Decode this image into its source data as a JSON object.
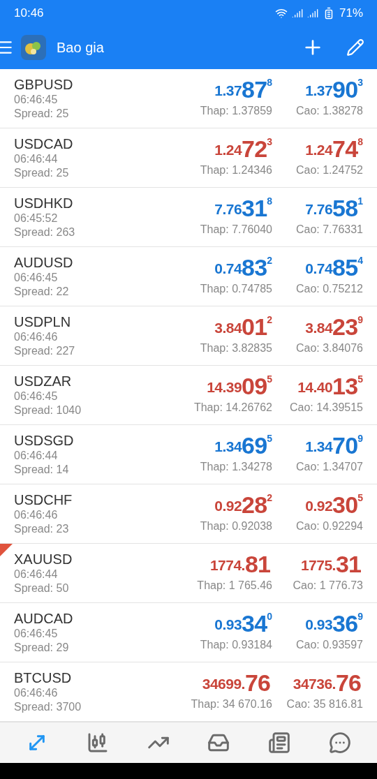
{
  "status_bar": {
    "time": "10:46",
    "battery": "71%"
  },
  "header": {
    "title": "Bao gia"
  },
  "quotes": [
    {
      "symbol": "GBPUSD",
      "time": "06:46:45",
      "spread": "Spread: 25",
      "rising": true,
      "marked": false,
      "bid": {
        "prefix": "1.37",
        "big": "87",
        "sup": "8"
      },
      "ask": {
        "prefix": "1.37",
        "big": "90",
        "sup": "3"
      },
      "low": "Thap: 1.37859",
      "high": "Cao: 1.38278"
    },
    {
      "symbol": "USDCAD",
      "time": "06:46:44",
      "spread": "Spread: 25",
      "rising": false,
      "marked": false,
      "bid": {
        "prefix": "1.24",
        "big": "72",
        "sup": "3"
      },
      "ask": {
        "prefix": "1.24",
        "big": "74",
        "sup": "8"
      },
      "low": "Thap: 1.24346",
      "high": "Cao: 1.24752"
    },
    {
      "symbol": "USDHKD",
      "time": "06:45:52",
      "spread": "Spread: 263",
      "rising": true,
      "marked": false,
      "bid": {
        "prefix": "7.76",
        "big": "31",
        "sup": "8"
      },
      "ask": {
        "prefix": "7.76",
        "big": "58",
        "sup": "1"
      },
      "low": "Thap: 7.76040",
      "high": "Cao: 7.76331"
    },
    {
      "symbol": "AUDUSD",
      "time": "06:46:45",
      "spread": "Spread: 22",
      "rising": true,
      "marked": false,
      "bid": {
        "prefix": "0.74",
        "big": "83",
        "sup": "2"
      },
      "ask": {
        "prefix": "0.74",
        "big": "85",
        "sup": "4"
      },
      "low": "Thap: 0.74785",
      "high": "Cao: 0.75212"
    },
    {
      "symbol": "USDPLN",
      "time": "06:46:46",
      "spread": "Spread: 227",
      "rising": false,
      "marked": false,
      "bid": {
        "prefix": "3.84",
        "big": "01",
        "sup": "2"
      },
      "ask": {
        "prefix": "3.84",
        "big": "23",
        "sup": "9"
      },
      "low": "Thap: 3.82835",
      "high": "Cao: 3.84076"
    },
    {
      "symbol": "USDZAR",
      "time": "06:46:45",
      "spread": "Spread: 1040",
      "rising": false,
      "marked": false,
      "bid": {
        "prefix": "14.39",
        "big": "09",
        "sup": "5"
      },
      "ask": {
        "prefix": "14.40",
        "big": "13",
        "sup": "5"
      },
      "low": "Thap: 14.26762",
      "high": "Cao: 14.39515"
    },
    {
      "symbol": "USDSGD",
      "time": "06:46:44",
      "spread": "Spread: 14",
      "rising": true,
      "marked": false,
      "bid": {
        "prefix": "1.34",
        "big": "69",
        "sup": "5"
      },
      "ask": {
        "prefix": "1.34",
        "big": "70",
        "sup": "9"
      },
      "low": "Thap: 1.34278",
      "high": "Cao: 1.34707"
    },
    {
      "symbol": "USDCHF",
      "time": "06:46:46",
      "spread": "Spread: 23",
      "rising": false,
      "marked": false,
      "bid": {
        "prefix": "0.92",
        "big": "28",
        "sup": "2"
      },
      "ask": {
        "prefix": "0.92",
        "big": "30",
        "sup": "5"
      },
      "low": "Thap: 0.92038",
      "high": "Cao: 0.92294"
    },
    {
      "symbol": "XAUUSD",
      "time": "06:46:44",
      "spread": "Spread: 50",
      "rising": false,
      "marked": true,
      "bid": {
        "prefix": "1774.",
        "big": "81"
      },
      "ask": {
        "prefix": "1775.",
        "big": "31"
      },
      "low": "Thap: 1 765.46",
      "high": "Cao: 1 776.73"
    },
    {
      "symbol": "AUDCAD",
      "time": "06:46:45",
      "spread": "Spread: 29",
      "rising": true,
      "marked": false,
      "bid": {
        "prefix": "0.93",
        "big": "34",
        "sup": "0"
      },
      "ask": {
        "prefix": "0.93",
        "big": "36",
        "sup": "9"
      },
      "low": "Thap: 0.93184",
      "high": "Cao: 0.93597"
    },
    {
      "symbol": "BTCUSD",
      "time": "06:46:46",
      "spread": "Spread: 3700",
      "rising": false,
      "marked": false,
      "bid": {
        "prefix": "34699.",
        "big": "76"
      },
      "ask": {
        "prefix": "34736.",
        "big": "76"
      },
      "low": "Thap: 34 670.16",
      "high": "Cao: 35 816.81"
    }
  ],
  "nav": [
    {
      "kind": "quotes",
      "selected": true
    },
    {
      "kind": "chart",
      "selected": false
    },
    {
      "kind": "trade",
      "selected": false
    },
    {
      "kind": "history",
      "selected": false
    },
    {
      "kind": "news",
      "selected": false
    },
    {
      "kind": "chat",
      "selected": false
    }
  ]
}
